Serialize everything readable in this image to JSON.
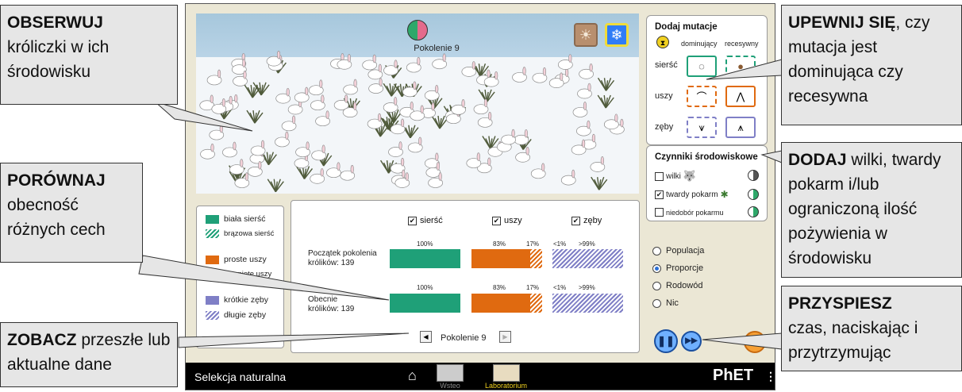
{
  "simulation": {
    "generation_label": "Pokolenie 9",
    "mutations": {
      "title": "Dodaj mutacje",
      "col_dominant": "dominujący",
      "col_recessive": "recesywny",
      "rows": [
        {
          "label": "sierść"
        },
        {
          "label": "uszy"
        },
        {
          "label": "zęby"
        }
      ]
    },
    "environment": {
      "title": "Czynniki środowiskowe",
      "factors": [
        {
          "label": "wilki",
          "checked": false
        },
        {
          "label": "twardy pokarm",
          "checked": true
        },
        {
          "label": "niedobór pokarmu",
          "checked": false
        }
      ]
    },
    "legend": [
      {
        "label": "biała sierść",
        "color": "#1fa078"
      },
      {
        "label": "brązowa sierść",
        "color": "#1fa078"
      },
      {
        "label": "proste uszy",
        "color": "#e06a10"
      },
      {
        "label": "klapnięte uszy",
        "color": "#e06a10"
      },
      {
        "label": "krótkie zęby",
        "color": "#7f7fc6"
      },
      {
        "label": "długie zęby",
        "color": "#7f7fc6"
      }
    ],
    "chart": {
      "traits": [
        "sierść",
        "uszy",
        "zęby"
      ],
      "rows": [
        {
          "label_line1": "Początek pokolenia",
          "label_line2": "królików: 139",
          "fur": [
            "100%"
          ],
          "ears": [
            "83%",
            "17%"
          ],
          "teeth": [
            "<1%",
            ">99%"
          ]
        },
        {
          "label_line1": "Obecnie",
          "label_line2": "królików: 139",
          "fur": [
            "100%"
          ],
          "ears": [
            "83%",
            "17%"
          ],
          "teeth": [
            "<1%",
            ">99%"
          ]
        }
      ],
      "generation_nav": "Pokolenie 9"
    },
    "view_options": [
      {
        "label": "Populacja",
        "selected": false
      },
      {
        "label": "Proporcje",
        "selected": true
      },
      {
        "label": "Rodowód",
        "selected": false
      },
      {
        "label": "Nic",
        "selected": false
      }
    ],
    "navbar": {
      "title": "Selekcja naturalna",
      "screens": [
        {
          "label": "Wsteo"
        },
        {
          "label": "Laboratorium"
        }
      ],
      "brand": "PhET"
    }
  },
  "callouts": {
    "observe": {
      "bold": "OBSERWUJ",
      "text": "króliczki w ich środowisku"
    },
    "compare": {
      "bold": "PORÓWNAJ",
      "text": "obecność różnych cech"
    },
    "view": {
      "bold": "ZOBACZ",
      "text": "przeszłe lub aktualne dane"
    },
    "ensure": {
      "bold": "UPEWNIJ SIĘ",
      "text": "czy mutacja jest dominująca czy recesywna"
    },
    "add": {
      "bold": "DODAJ",
      "text": "wilki, twardy pokarm i/lub ograniczoną ilość pożywienia w środowisku"
    },
    "speed": {
      "bold": "PRZYSPIESZ",
      "text": "czas, naciskając i przytrzymując"
    }
  }
}
